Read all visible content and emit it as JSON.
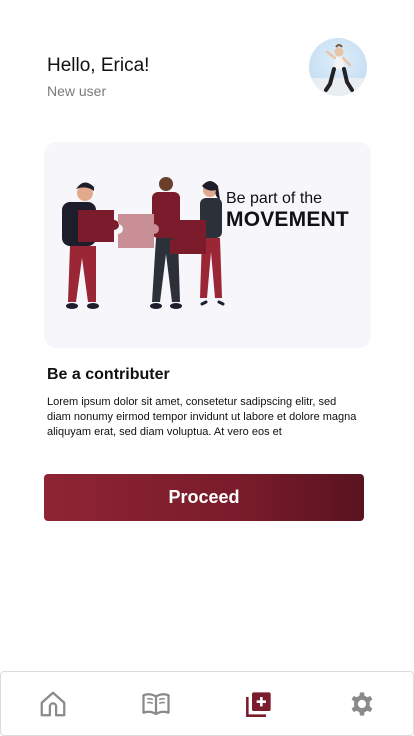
{
  "header": {
    "greeting": "Hello, Erica!",
    "subtitle": "New user"
  },
  "banner": {
    "line1": "Be part of the",
    "line2": "MOVEMENT"
  },
  "section": {
    "title": "Be a contributer",
    "body": "Lorem ipsum dolor sit amet, consetetur sadipscing elitr, sed diam nonumy eirmod tempor invidunt ut labore et dolore magna aliquyam erat, sed diam voluptua. At vero eos et"
  },
  "actions": {
    "proceed_label": "Proceed"
  },
  "nav": {
    "items": [
      {
        "icon": "home-icon",
        "active": false
      },
      {
        "icon": "book-icon",
        "active": false
      },
      {
        "icon": "add-collection-icon",
        "active": true
      },
      {
        "icon": "gear-icon",
        "active": false
      }
    ],
    "active_color": "#7a1c2b",
    "inactive_color": "#8a8a8a"
  },
  "colors": {
    "accent": "#7a1c2b",
    "banner_bg": "#f7f6fb"
  }
}
